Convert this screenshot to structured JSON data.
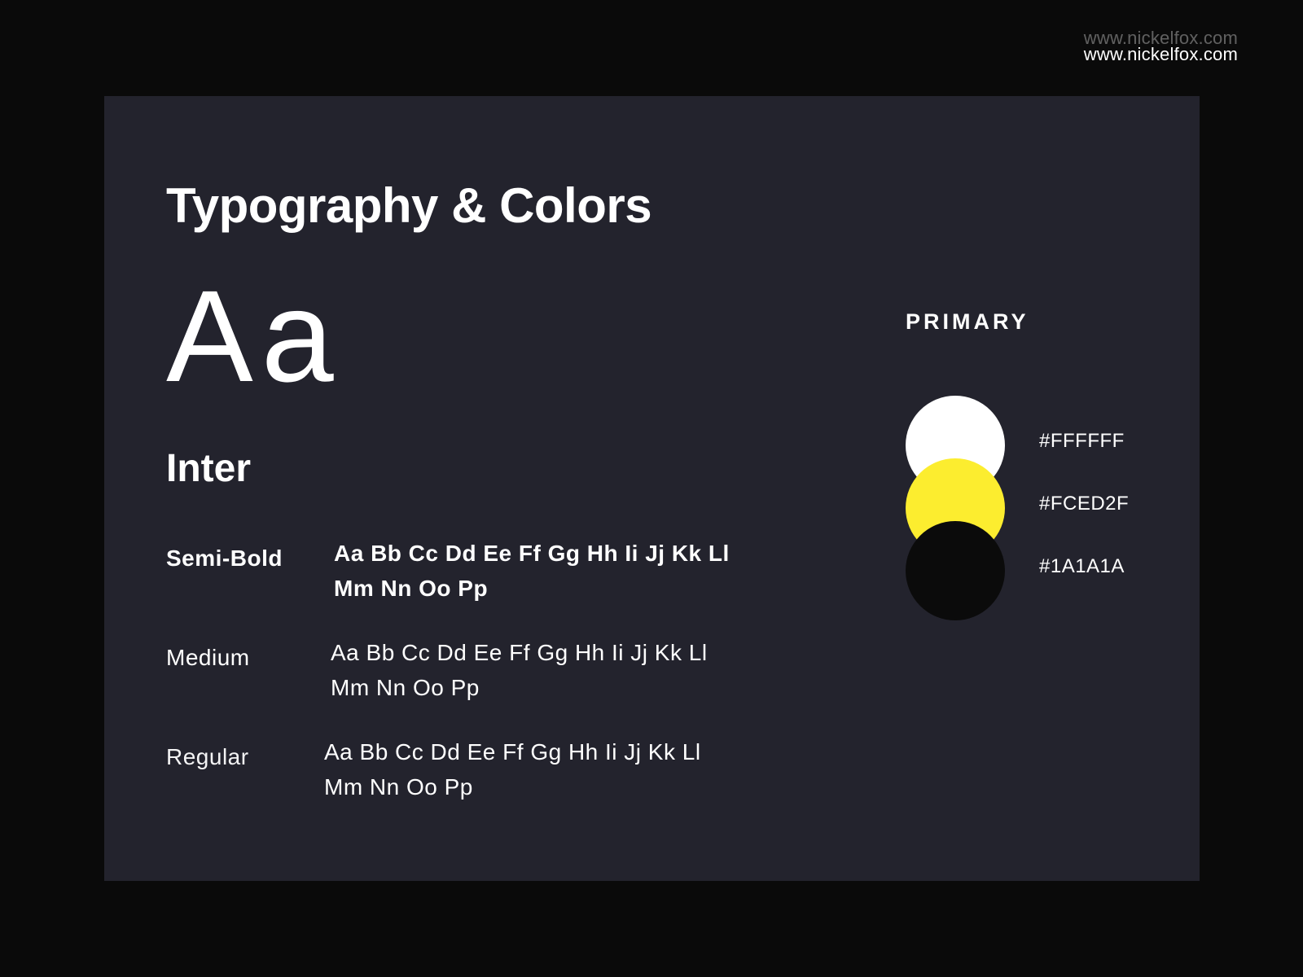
{
  "header": {
    "url": "www.nickelfox.com"
  },
  "card": {
    "title": "Typography & Colors",
    "specimen": "Aa",
    "font_name": "Inter",
    "weights": [
      {
        "label": "Semi-Bold",
        "line1": "Aa Bb Cc Dd Ee Ff Gg Hh Ii Jj Kk Ll",
        "line2": "Mm Nn Oo Pp"
      },
      {
        "label": "Medium",
        "line1": "Aa Bb Cc Dd Ee Ff Gg Hh Ii Jj Kk Ll",
        "line2": "Mm Nn Oo Pp"
      },
      {
        "label": "Regular",
        "line1": "Aa Bb Cc Dd Ee Ff Gg Hh Ii Jj Kk Ll",
        "line2": "Mm Nn Oo Pp"
      }
    ],
    "palette": {
      "label": "PRIMARY",
      "colors": [
        {
          "hex": "#FFFFFF",
          "color": "#FFFFFF"
        },
        {
          "hex": "#FCED2F",
          "color": "#FCED2F"
        },
        {
          "hex": "#1A1A1A",
          "color": "#0B0B0B"
        }
      ]
    }
  }
}
